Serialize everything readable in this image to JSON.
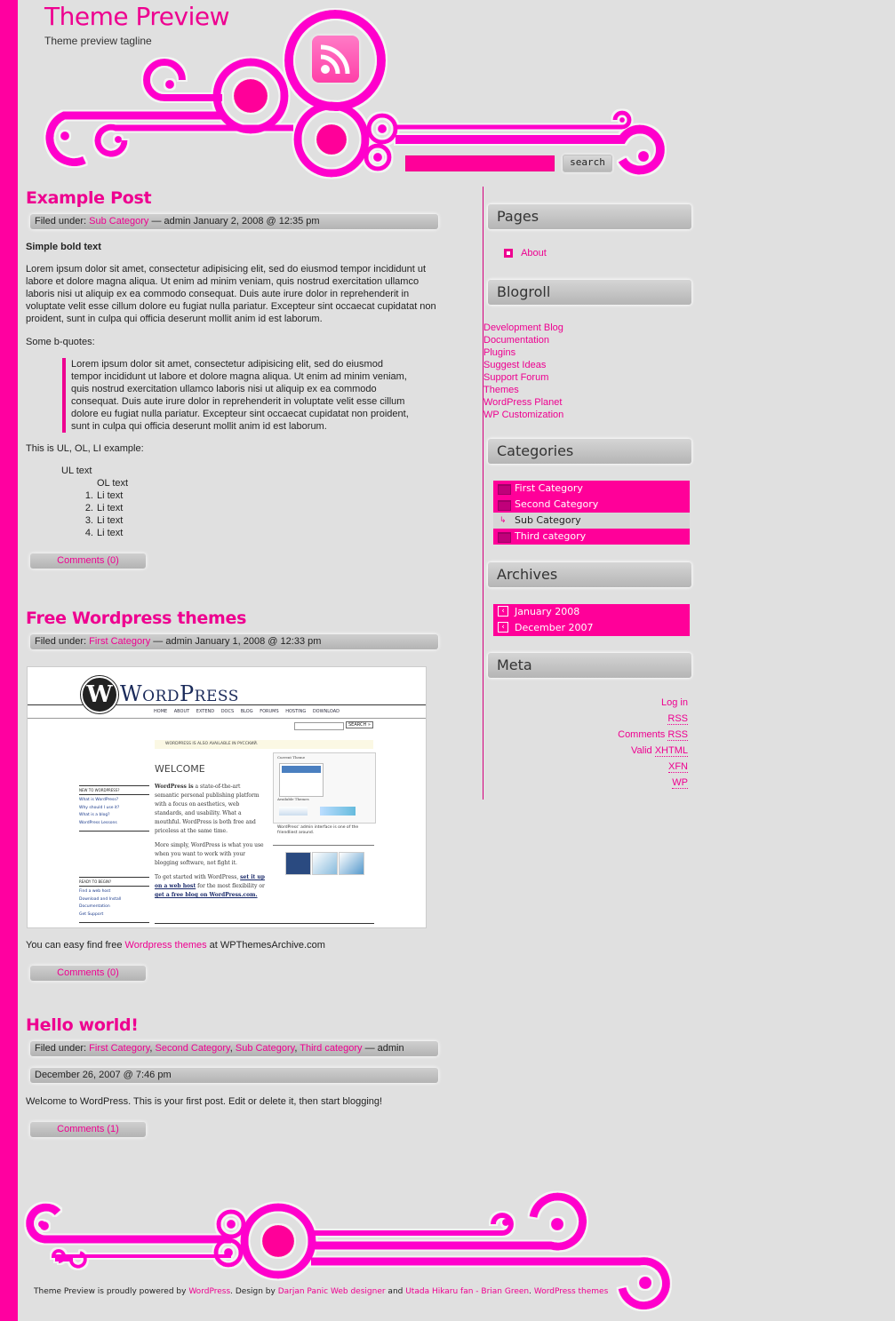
{
  "header": {
    "site_title": "Theme Preview",
    "tagline": "Theme preview tagline",
    "rss_icon": "rss-feed-icon",
    "search_value": "",
    "search_button": "search"
  },
  "colors": {
    "accent": "#ee0090",
    "bar": "#ff00a0",
    "background": "#e0e0e0"
  },
  "posts": [
    {
      "title": "Example Post",
      "meta": {
        "prefix": "Filed under: ",
        "categories": [
          "Sub Category"
        ],
        "suffix": " — admin January 2, 2008 @ 12:35 pm"
      },
      "bold_text": "Simple bold text",
      "paragraph": "Lorem ipsum dolor sit amet, consectetur adipisicing elit, sed do eiusmod tempor incididunt ut labore et dolore magna aliqua. Ut enim ad minim veniam, quis nostrud exercitation ullamco laboris nisi ut aliquip ex ea commodo consequat. Duis aute irure dolor in reprehenderit in voluptate velit esse cillum dolore eu fugiat nulla pariatur. Excepteur sint occaecat cupidatat non proident, sunt in culpa qui officia deserunt mollit anim id est laborum.",
      "bquote_label": "Some b-quotes:",
      "blockquote": "Lorem ipsum dolor sit amet, consectetur adipisicing elit, sed do eiusmod tempor incididunt ut labore et dolore magna aliqua. Ut enim ad minim veniam, quis nostrud exercitation ullamco laboris nisi ut aliquip ex ea commodo consequat. Duis aute irure dolor in reprehenderit in voluptate velit esse cillum dolore eu fugiat nulla pariatur. Excepteur sint occaecat cupidatat non proident, sunt in culpa qui officia deserunt mollit anim id est laborum.",
      "list_label": "This is UL, OL, LI example:",
      "ul_text": "UL text",
      "ol_text": "OL text",
      "li_items": [
        "Li text",
        "Li text",
        "Li text",
        "Li text"
      ],
      "comments": "Comments (0)"
    },
    {
      "title": "Free Wordpress themes",
      "meta": {
        "prefix": "Filed under: ",
        "categories": [
          "First Category"
        ],
        "suffix": " — admin January 1, 2008 @ 12:33 pm"
      },
      "image": {
        "brand": "WordPress",
        "nav": [
          "HOME",
          "ABOUT",
          "EXTEND",
          "DOCS",
          "BLOG",
          "FORUMS",
          "HOSTING",
          "DOWNLOAD"
        ],
        "search_button": "SEARCH »",
        "notice": "WORDPRESS IS ALSO AVAILABLE IN РУССКИЙ.",
        "welcome": "WELCOME",
        "new_heading": "NEW TO WORDPRESS?",
        "new_links": [
          "What is WordPress?",
          "Why should I use it?",
          "What is a blog?",
          "WordPress Lessons"
        ],
        "ready_heading": "READY TO BEGIN?",
        "ready_links": [
          "Find a web host",
          "Download and Install",
          "Documentation",
          "Get Support"
        ],
        "intro_bold": "WordPress is",
        "intro": " a state-of-the-art semantic personal publishing platform with a focus on aesthetics, web standards, and usability. What a mouthful. WordPress is both free and priceless at the same time.",
        "para2": "More simply, WordPress is what you use when you want to work with your blogging software, not fight it.",
        "para3_a": "To get started with WordPress, ",
        "para3_link1": "set it up on a web host",
        "para3_b": " for the most flexibility or ",
        "para3_link2": "get a free blog on WordPress.com.",
        "current_theme": "Current Theme",
        "available_themes": "Available Themes",
        "caption": "WordPress' admin interface is one of the friendliest around."
      },
      "text_before": "You can easy find free ",
      "text_link": "Wordpress themes",
      "text_after": " at WPThemesArchive.com",
      "comments": "Comments (0)"
    },
    {
      "title": "Hello world!",
      "meta": {
        "prefix": "Filed under: ",
        "categories": [
          "First Category",
          "Second Category",
          "Sub Category",
          "Third category"
        ],
        "suffix": " — admin"
      },
      "date": "December 26, 2007 @ 7:46 pm",
      "paragraph": "Welcome to WordPress. This is your first post. Edit or delete it, then start blogging!",
      "comments": "Comments (1)"
    }
  ],
  "sidebar": {
    "pages": {
      "title": "Pages",
      "items": [
        "About"
      ]
    },
    "blogroll": {
      "title": "Blogroll",
      "items": [
        "Development Blog",
        "Documentation",
        "Plugins",
        "Suggest Ideas",
        "Support Forum",
        "Themes",
        "WordPress Planet",
        "WP Customization"
      ]
    },
    "categories": {
      "title": "Categories",
      "items": [
        {
          "label": "First Category",
          "icon": "folder-icon"
        },
        {
          "label": "Second Category",
          "icon": "folder-icon"
        },
        {
          "label": "Sub Category",
          "icon": "sub-arrow-icon"
        },
        {
          "label": "Third category",
          "icon": "folder-icon"
        }
      ]
    },
    "archives": {
      "title": "Archives",
      "items": [
        "January 2008",
        "December 2007"
      ]
    },
    "meta": {
      "title": "Meta",
      "items": [
        {
          "pre": "",
          "link": "Log in"
        },
        {
          "pre": "",
          "link": "RSS"
        },
        {
          "pre": "Comments ",
          "link": "RSS"
        },
        {
          "pre": "Valid ",
          "link": "XHTML"
        },
        {
          "pre": "",
          "link": "XFN"
        },
        {
          "pre": "",
          "link": "WP"
        }
      ]
    }
  },
  "footer": {
    "t1": "Theme Preview is proudly powered by ",
    "l1": "WordPress",
    "t2": ". Design by ",
    "l2": "Darjan Panic Web designer",
    "t3": " and ",
    "l3": "Utada Hikaru fan - Brian Green",
    "t4": ". ",
    "l4": "WordPress themes"
  }
}
